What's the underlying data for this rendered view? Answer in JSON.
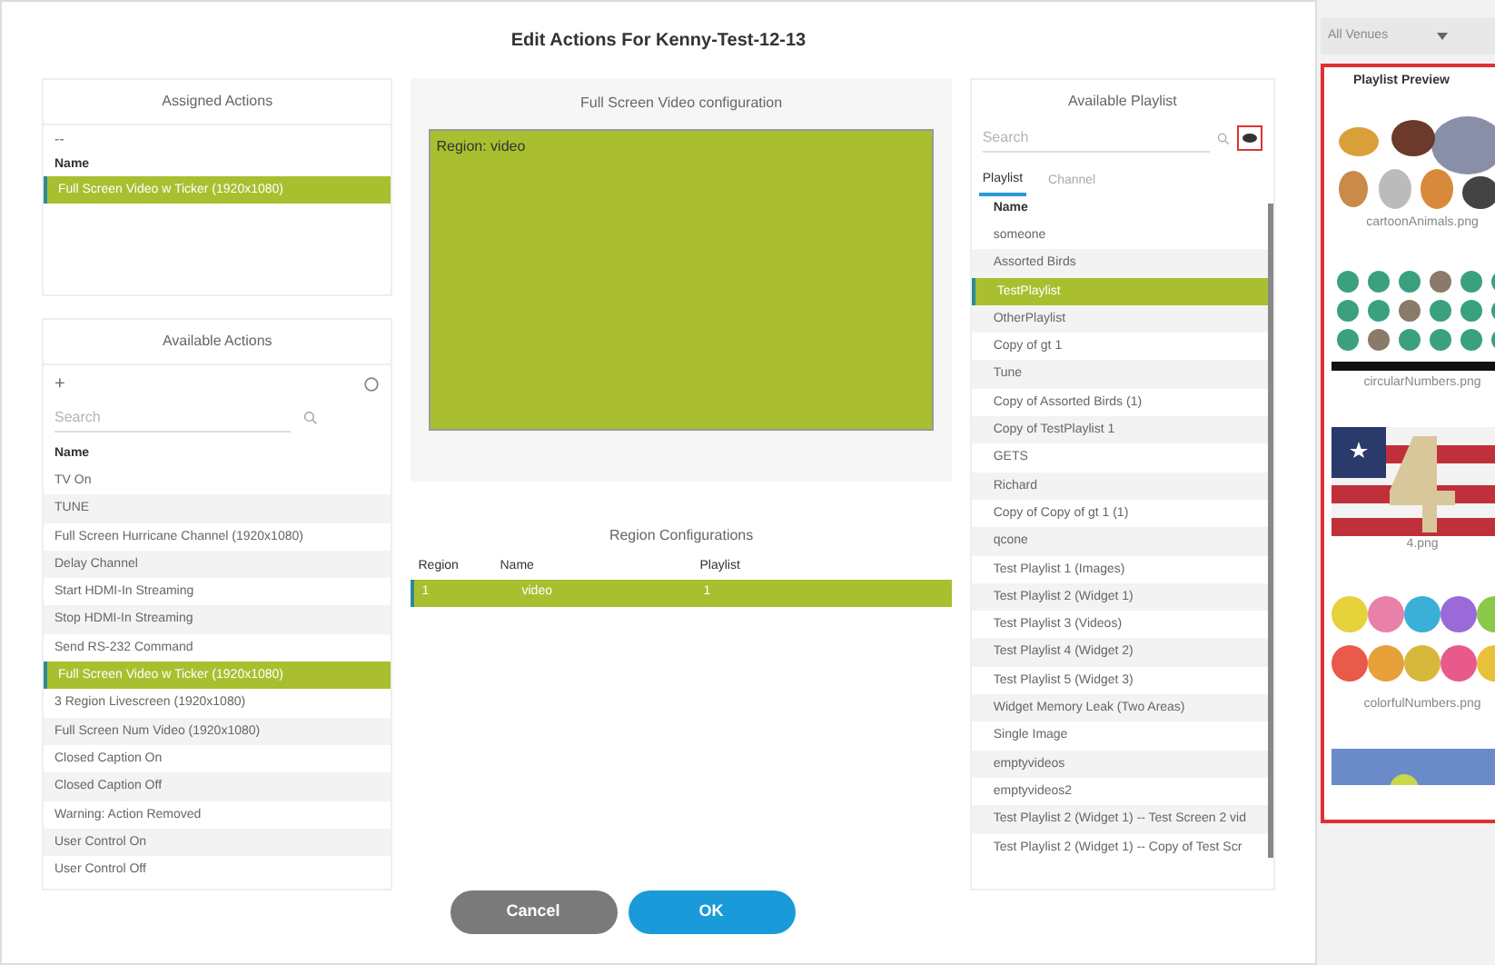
{
  "dialog": {
    "title": "Edit Actions For Kenny-Test-12-13"
  },
  "assigned_actions": {
    "title": "Assigned Actions",
    "filter": "--",
    "column": "Name",
    "rows": [
      {
        "name": "Full Screen Video w Ticker (1920x1080)",
        "selected": true
      }
    ]
  },
  "available_actions": {
    "title": "Available Actions",
    "add": "+",
    "search": {
      "placeholder": "Search"
    },
    "column": "Name",
    "rows": [
      {
        "name": "TV On",
        "selected": false
      },
      {
        "name": "TUNE",
        "selected": false
      },
      {
        "name": "Full Screen Hurricane Channel (1920x1080)",
        "selected": false
      },
      {
        "name": "Delay Channel",
        "selected": false
      },
      {
        "name": "Start HDMI-In Streaming",
        "selected": false
      },
      {
        "name": "Stop HDMI-In Streaming",
        "selected": false
      },
      {
        "name": "Send RS-232 Command",
        "selected": false
      },
      {
        "name": "Full Screen Video w Ticker (1920x1080)",
        "selected": true
      },
      {
        "name": "3 Region Livescreen (1920x1080)",
        "selected": false
      },
      {
        "name": "Full Screen Num Video (1920x1080)",
        "selected": false
      },
      {
        "name": "Closed Caption On",
        "selected": false
      },
      {
        "name": "Closed Caption Off",
        "selected": false
      },
      {
        "name": "Warning: Action Removed",
        "selected": false
      },
      {
        "name": "User Control On",
        "selected": false
      },
      {
        "name": "User Control Off",
        "selected": false
      }
    ]
  },
  "configuration": {
    "title": "Full Screen Video configuration",
    "regions": [
      {
        "label": "Region: video",
        "color": "#a9bf2f"
      }
    ]
  },
  "region_configurations": {
    "title": "Region Configurations",
    "columns": [
      "Region",
      "Name",
      "Playlist"
    ],
    "rows": [
      {
        "cells": [
          "1",
          "video",
          "1"
        ],
        "selected": true
      }
    ]
  },
  "available_playlist": {
    "title": "Available Playlist",
    "search": {
      "placeholder": "Search"
    },
    "tabs": [
      {
        "label": "Playlist",
        "selected": true
      },
      {
        "label": "Channel",
        "selected": false
      }
    ],
    "column": "Name",
    "rows": [
      {
        "name": "someone",
        "selected": false
      },
      {
        "name": "Assorted Birds",
        "selected": false
      },
      {
        "name": "TestPlaylist",
        "selected": true
      },
      {
        "name": "OtherPlaylist",
        "selected": false
      },
      {
        "name": "Copy of gt 1",
        "selected": false
      },
      {
        "name": "Tune",
        "selected": false
      },
      {
        "name": "Copy of Assorted Birds (1)",
        "selected": false
      },
      {
        "name": "Copy of TestPlaylist 1",
        "selected": false
      },
      {
        "name": "GETS",
        "selected": false
      },
      {
        "name": "Richard",
        "selected": false
      },
      {
        "name": "Copy of Copy of gt 1 (1)",
        "selected": false
      },
      {
        "name": "qcone",
        "selected": false
      },
      {
        "name": "Test Playlist 1 (Images)",
        "selected": false
      },
      {
        "name": "Test Playlist 2 (Widget 1)",
        "selected": false
      },
      {
        "name": "Test Playlist 3 (Videos)",
        "selected": false
      },
      {
        "name": "Test Playlist 4 (Widget 2)",
        "selected": false
      },
      {
        "name": "Test Playlist 5 (Widget 3)",
        "selected": false
      },
      {
        "name": "Widget Memory Leak (Two Areas)",
        "selected": false
      },
      {
        "name": "Single Image",
        "selected": false
      },
      {
        "name": "emptyvideos",
        "selected": false
      },
      {
        "name": "emptyvideos2",
        "selected": false
      },
      {
        "name": "Test Playlist 2 (Widget 1) -- Test Screen 2 vid",
        "selected": false
      },
      {
        "name": "Test Playlist 2 (Widget 1) -- Copy of Test Scr",
        "selected": false
      }
    ]
  },
  "venue_filter": {
    "value": "All Venues"
  },
  "playlist_preview": {
    "title": "Playlist Preview",
    "items": [
      {
        "caption": "cartoonAnimals.png",
        "kind": "picture"
      },
      {
        "caption": "circularNumbers.png",
        "kind": "picture"
      },
      {
        "caption": "4.png",
        "kind": "picture"
      },
      {
        "caption": "colorfulNumbers.png",
        "kind": "picture"
      },
      {
        "kind": "picture"
      }
    ]
  },
  "buttons": [
    {
      "label": "Cancel",
      "kind": "secondary"
    },
    {
      "label": "OK",
      "kind": "primary"
    }
  ]
}
